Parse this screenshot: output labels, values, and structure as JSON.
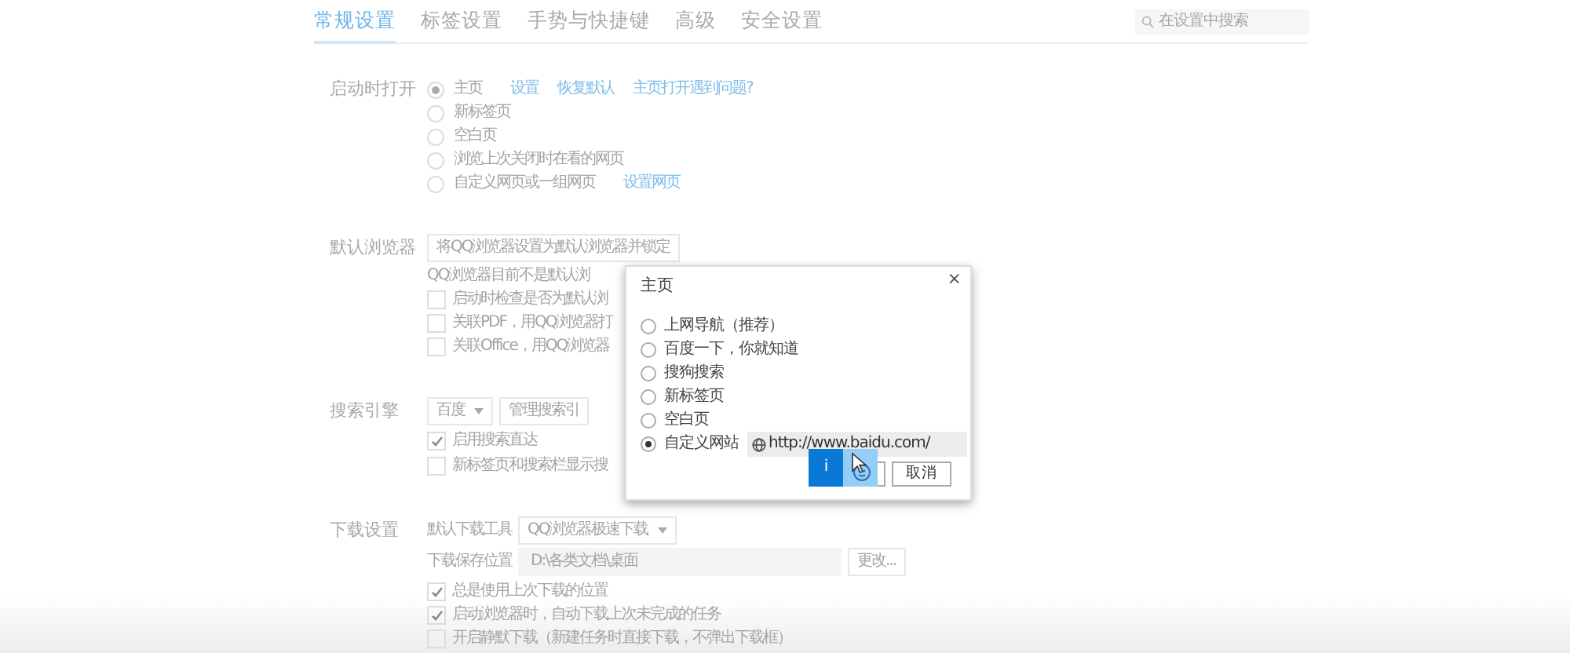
{
  "tabs": [
    {
      "label": "常规设置",
      "selected": true
    },
    {
      "label": "标签设置",
      "selected": false
    },
    {
      "label": "手势与快捷键",
      "selected": false
    },
    {
      "label": "高级",
      "selected": false
    },
    {
      "label": "安全设置",
      "selected": false
    }
  ],
  "search": {
    "placeholder": "在设置中搜索"
  },
  "sections": [
    {
      "kind": "radios",
      "label": "启动时打开",
      "options": [
        {
          "label": "主页",
          "selected": true,
          "links": [
            "设置",
            "恢复默认",
            "主页打开遇到问题?"
          ]
        },
        {
          "label": "新标签页",
          "selected": false
        },
        {
          "label": "空白页",
          "selected": false
        },
        {
          "label": "浏览上次关闭时在看的网页",
          "selected": false
        },
        {
          "label": "自定义网页或一组网页",
          "selected": false,
          "links": [
            "设置网页"
          ]
        }
      ]
    },
    {
      "kind": "browser",
      "label": "默认浏览器",
      "button": "将QQ浏览器设置为默认浏览器并锁定",
      "note": "QQ浏览器目前不是默认浏",
      "checkboxes": [
        {
          "label": "启动时检查是否为默认浏",
          "checked": false
        },
        {
          "label": "关联PDF，用QQ浏览器打",
          "checked": false
        },
        {
          "label": "关联Office，用QQ浏览器",
          "checked": false
        }
      ]
    },
    {
      "kind": "engine",
      "label": "搜索引擎",
      "select": "百度",
      "button": "管理搜索引",
      "checkboxes": [
        {
          "label": "启用搜索直达",
          "checked": true
        },
        {
          "label": "新标签页和搜索栏显示搜",
          "checked": false
        }
      ]
    },
    {
      "kind": "download",
      "label": "下载设置",
      "tool_label": "默认下载工具",
      "tool": "QQ浏览器极速下载",
      "path_label": "下载保存位置",
      "path": "D:\\各类文档\\桌面",
      "path_button": "更改...",
      "checkboxes": [
        {
          "label": "总是使用上次下载的位置",
          "checked": true
        },
        {
          "label": "启动浏览器时，自动下载上次未完成的任务",
          "checked": true
        },
        {
          "label": "开启静默下载（新建任务时直接下载，不弹出下载框）",
          "checked": false
        }
      ]
    }
  ],
  "dialog": {
    "title": "主页",
    "close": "×",
    "options": [
      {
        "label": "上网导航（推荐）",
        "selected": false
      },
      {
        "label": "百度一下，你就知道",
        "selected": false
      },
      {
        "label": "搜狗搜索",
        "selected": false
      },
      {
        "label": "新标签页",
        "selected": false
      },
      {
        "label": "空白页",
        "selected": false
      },
      {
        "label": "自定义网站",
        "selected": true
      }
    ],
    "url": "http://www.baidu.com/",
    "cancel": "取消",
    "overlay": {
      "label": "i"
    }
  }
}
